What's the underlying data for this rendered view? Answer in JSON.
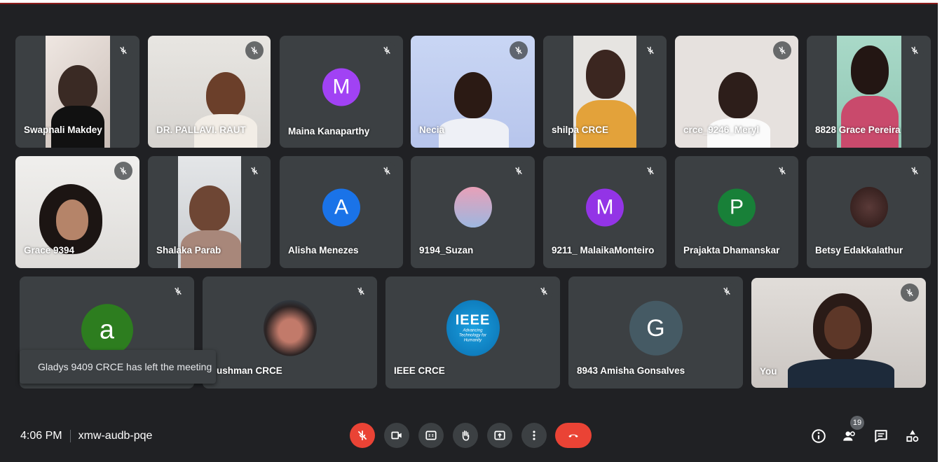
{
  "participants": [
    {
      "name": "Swapnali Makdey"
    },
    {
      "name": "DR. PALLAVI. RAUT"
    },
    {
      "name": "Maina Kanaparthy",
      "initial": "M",
      "color": "#a142f4"
    },
    {
      "name": "Necia"
    },
    {
      "name": "shilpa CRCE"
    },
    {
      "name": "crce_9246_Meryl"
    },
    {
      "name": "8828 Grace Pereira"
    },
    {
      "name": "Grace 9394"
    },
    {
      "name": "Shalaka Parab"
    },
    {
      "name": "Alisha Menezes",
      "initial": "A",
      "color": "#1a73e8"
    },
    {
      "name": "9194_Suzan"
    },
    {
      "name": "9211_ MalaikaMonteiro",
      "initial": "M",
      "color": "#9334e6"
    },
    {
      "name": "Prajakta Dhamanskar",
      "initial": "P",
      "color": "#188038"
    },
    {
      "name": "Betsy Edakkalathur"
    },
    {
      "name": "",
      "initial": "a",
      "color": "#2d7d1f"
    },
    {
      "name": "ushman CRCE"
    },
    {
      "name": "IEEE CRCE",
      "logo_text": "IEEE",
      "logo_subtext": "Advancing Technology for Humanity"
    },
    {
      "name": "8943 Amisha Gonsalves",
      "initial": "G",
      "color": "#455a64"
    },
    {
      "name": "You"
    }
  ],
  "toast": "Gladys 9409 CRCE has left the meeting",
  "meeting": {
    "time": "4:06 PM",
    "code": "xmw-audb-pqe"
  },
  "controls": {
    "mic": "mic-off-icon",
    "camera": "camera-icon",
    "captions": "captions-icon",
    "raise_hand": "raise-hand-icon",
    "present": "present-screen-icon",
    "more": "more-options-icon",
    "leave": "leave-call-icon"
  },
  "right_controls": {
    "people_count": "19"
  },
  "colors": {
    "background": "#202124",
    "tile": "#3c4043",
    "danger": "#ea4335"
  }
}
